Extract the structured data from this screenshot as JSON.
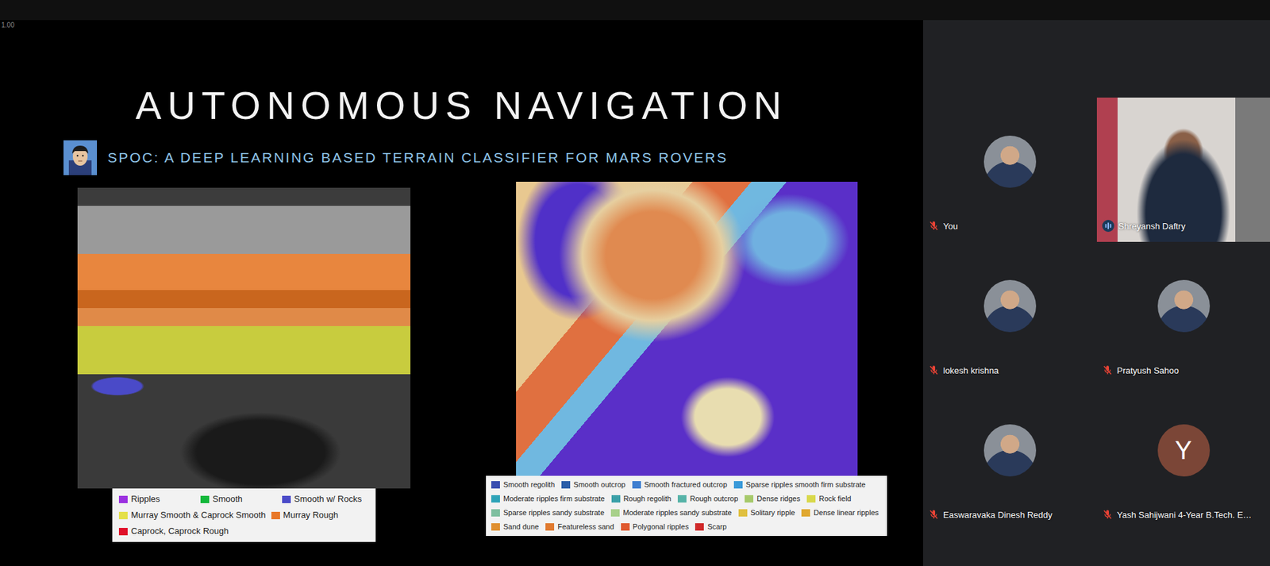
{
  "top_bar": {
    "zoom_label": "1.00"
  },
  "slide": {
    "title": "AUTONOMOUS NAVIGATION",
    "subtitle": "SPOC: A DEEP LEARNING BASED TERRAIN CLASSIFIER FOR MARS ROVERS",
    "figures": [
      {
        "legend": [
          {
            "label": "Ripples",
            "color": "#9b30e0"
          },
          {
            "label": "Smooth",
            "color": "#12b83a"
          },
          {
            "label": "Smooth w/ Rocks",
            "color": "#4a4ac8"
          },
          {
            "label": "Murray Smooth & Caprock Smooth",
            "color": "#e4e04a"
          },
          {
            "label": "Murray Rough",
            "color": "#e8782a"
          },
          {
            "label": "Caprock, Caprock Rough",
            "color": "#e0102a"
          }
        ]
      },
      {
        "legend": [
          {
            "label": "Smooth regolith",
            "color": "#3a4fb0"
          },
          {
            "label": "Smooth outcrop",
            "color": "#2b5fa8"
          },
          {
            "label": "Smooth fractured outcrop",
            "color": "#3f7fd0"
          },
          {
            "label": "Sparse ripples smooth firm substrate",
            "color": "#3a9ad9"
          },
          {
            "label": "Moderate ripples firm substrate",
            "color": "#2ea3b8"
          },
          {
            "label": "Rough regolith",
            "color": "#3aa0a8"
          },
          {
            "label": "Rough outcrop",
            "color": "#56b3a8"
          },
          {
            "label": "Dense ridges",
            "color": "#a6c96a"
          },
          {
            "label": "Rock field",
            "color": "#d8d84a"
          },
          {
            "label": "Sparse ripples sandy substrate",
            "color": "#7fbfa0"
          },
          {
            "label": "Moderate ripples sandy substrate",
            "color": "#a8d08a"
          },
          {
            "label": "Solitary ripple",
            "color": "#e0c040"
          },
          {
            "label": "Dense linear ripples",
            "color": "#e0a830"
          },
          {
            "label": "Sand dune",
            "color": "#e09030"
          },
          {
            "label": "Featureless sand",
            "color": "#e07a30"
          },
          {
            "label": "Polygonal ripples",
            "color": "#e05a30"
          },
          {
            "label": "Scarp",
            "color": "#d02a2a"
          }
        ]
      }
    ]
  },
  "participants": [
    {
      "name": "You",
      "kind": "photo",
      "muted": true,
      "speaking": false,
      "initial": ""
    },
    {
      "name": "Shreyansh Daftry",
      "kind": "video",
      "muted": false,
      "speaking": true,
      "initial": ""
    },
    {
      "name": "lokesh krishna",
      "kind": "photo",
      "muted": true,
      "speaking": false,
      "initial": ""
    },
    {
      "name": "Pratyush Sahoo",
      "kind": "photo",
      "muted": true,
      "speaking": false,
      "initial": ""
    },
    {
      "name": "Easwaravaka Dinesh Reddy",
      "kind": "photo",
      "muted": true,
      "speaking": false,
      "initial": ""
    },
    {
      "name": "Yash Sahijwani 4-Year B.Tech. E…",
      "kind": "letter",
      "muted": true,
      "speaking": false,
      "initial": "Y"
    }
  ]
}
